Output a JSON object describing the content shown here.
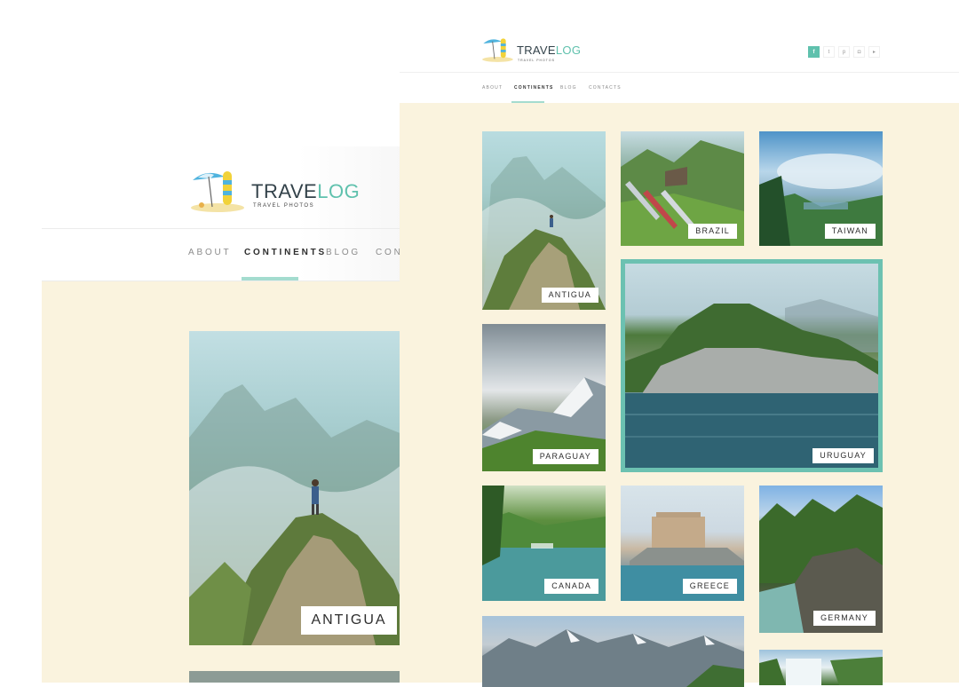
{
  "back_page": {
    "brand": {
      "name_part1": "TRAVE",
      "name_part2": "LOG",
      "tagline": "TRAVEL PHOTOS"
    },
    "nav": [
      {
        "label": "ABOUT"
      },
      {
        "label": "CONTINENTS",
        "active": true
      },
      {
        "label": "BLOG"
      },
      {
        "label": "CONTA"
      }
    ],
    "featured": {
      "label": "ANTIGUA"
    }
  },
  "front_page": {
    "brand": {
      "name_part1": "TRAVE",
      "name_part2": "LOG",
      "tagline": "TRAVEL PHOTOS"
    },
    "nav": [
      {
        "label": "ABOUT"
      },
      {
        "label": "CONTINENTS",
        "active": true
      },
      {
        "label": "BLOG"
      },
      {
        "label": "CONTACTS"
      }
    ],
    "social": [
      {
        "icon": "facebook-icon",
        "glyph": "f"
      },
      {
        "icon": "twitter-icon",
        "glyph": "t"
      },
      {
        "icon": "pinterest-icon",
        "glyph": "p"
      },
      {
        "icon": "instagram-icon",
        "glyph": "◘"
      },
      {
        "icon": "youtube-icon",
        "glyph": "▸"
      }
    ],
    "gallery": [
      {
        "label": "ANTIGUA"
      },
      {
        "label": "BRAZIL"
      },
      {
        "label": "TAIWAN"
      },
      {
        "label": "PARAGUAY"
      },
      {
        "label": "URUGUAY",
        "featured": true
      },
      {
        "label": "CANADA"
      },
      {
        "label": "GREECE"
      },
      {
        "label": "GERMANY"
      }
    ]
  },
  "colors": {
    "accent": "#5fc1ad",
    "underline": "#a4dccf",
    "cream_bg": "#faf3de",
    "text_dark": "#33424a"
  }
}
